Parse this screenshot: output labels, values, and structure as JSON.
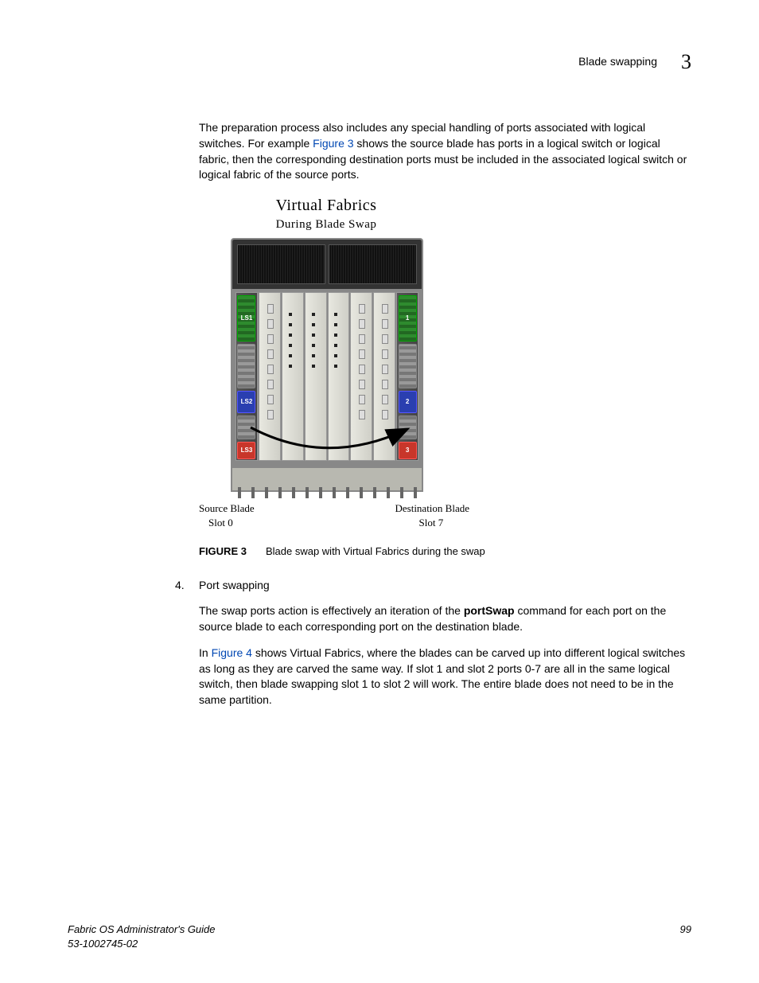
{
  "header": {
    "title": "Blade swapping",
    "chapter": "3"
  },
  "intro": {
    "pre": "The preparation process also includes any special handling of ports associated with logical switches. For example ",
    "link": "Figure 3",
    "post": " shows the source blade has ports in a logical switch or logical fabric, then the corresponding destination ports must be included in the associated logical switch or logical fabric of the source ports."
  },
  "figure": {
    "title1": "Virtual Fabrics",
    "title2": "During Blade Swap",
    "ls1": "LS1",
    "ls2": "LS2",
    "ls3": "LS3",
    "d1": "1",
    "d2": "2",
    "d3": "3",
    "src_label_line1": "Source Blade",
    "src_label_line2": "Slot 0",
    "dst_label_line1": "Destination Blade",
    "dst_label_line2": "Slot 7",
    "caption_num": "FIGURE 3",
    "caption_text": "Blade swap with Virtual Fabrics during the swap"
  },
  "step": {
    "number": "4.",
    "title": "Port swapping",
    "para1_pre": "The swap ports action is effectively an iteration of the ",
    "para1_bold": "portSwap",
    "para1_post": " command for each port on the source blade to each corresponding port on the destination blade.",
    "para2_pre": "In ",
    "para2_link": "Figure 4",
    "para2_post": " shows Virtual Fabrics, where the blades can be carved up into different logical switches as long as they are carved the same way. If slot 1 and slot 2 ports 0-7 are all in the same logical switch, then blade swapping slot 1 to slot 2 will work. The entire blade does not need to be in the same partition."
  },
  "footer": {
    "guide": "Fabric OS Administrator's Guide",
    "docnum": "53-1002745-02",
    "page": "99"
  }
}
